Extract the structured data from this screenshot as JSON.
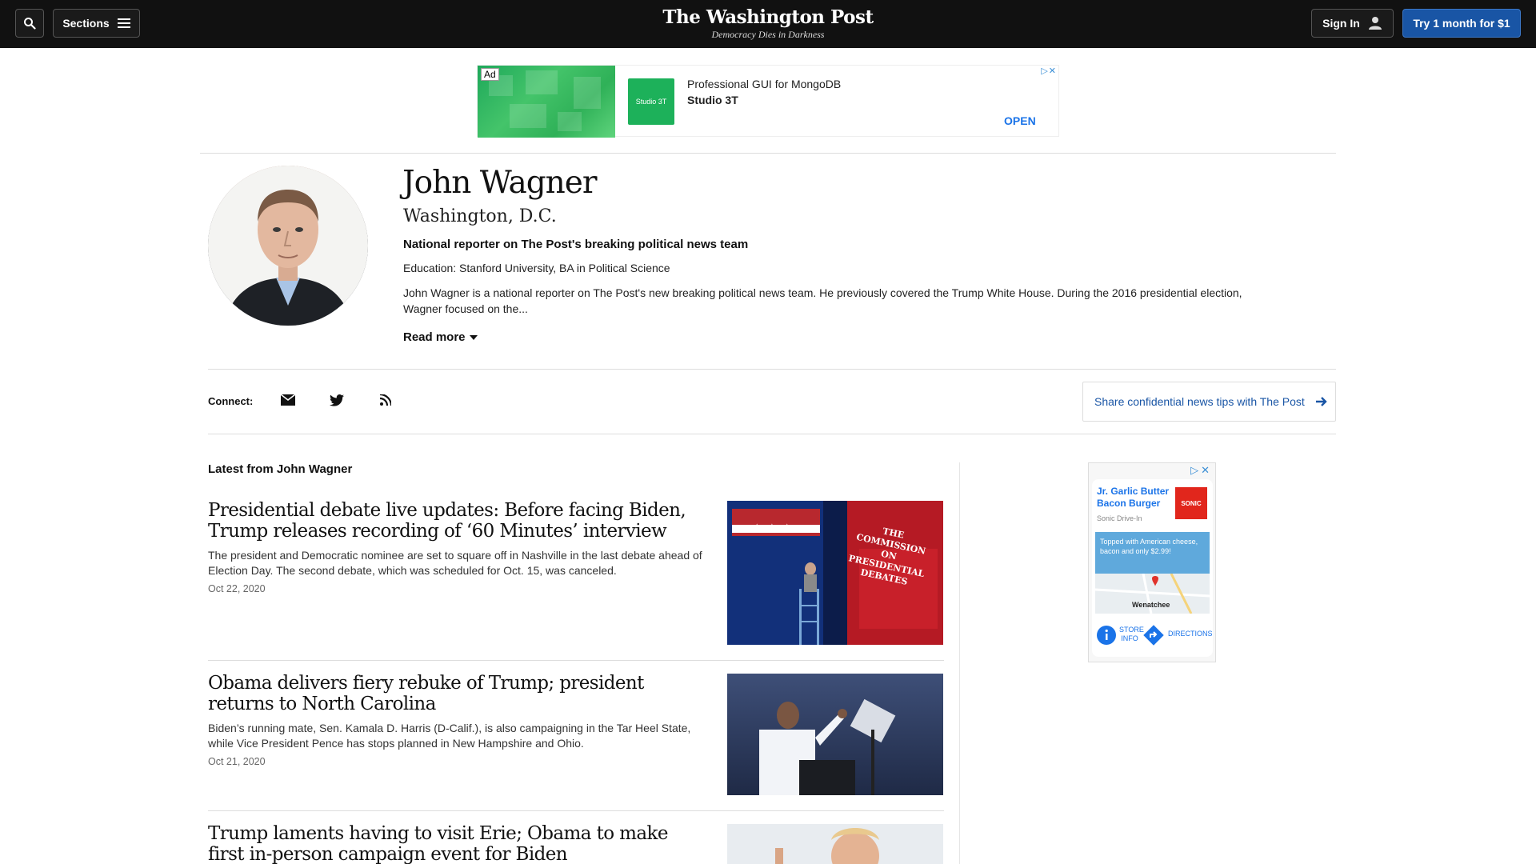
{
  "header": {
    "sections_label": "Sections",
    "logo_text": "The Washington Post",
    "tagline": "Democracy Dies in Darkness",
    "signin_label": "Sign In",
    "trial_label": "Try 1 month for $1"
  },
  "top_ad": {
    "badge": "Ad",
    "logo_text": "Studio 3T",
    "headline": "Professional GUI for MongoDB",
    "advertiser": "Studio 3T",
    "cta": "OPEN",
    "adchoices": "▷✕"
  },
  "profile": {
    "name": "John Wagner",
    "location": "Washington, D.C.",
    "role": "National reporter on The Post's breaking political news team",
    "education": "Education: Stanford University, BA in Political Science",
    "bio": "John Wagner is a national reporter on The Post's new breaking political news team. He previously covered the Trump White House. During the 2016 presidential election, Wagner focused on the...",
    "read_more": "Read more"
  },
  "connect": {
    "label": "Connect:",
    "icons": [
      "mail-icon",
      "twitter-icon",
      "rss-icon"
    ],
    "tips_label": "Share confidential news tips with The Post"
  },
  "latest": {
    "heading": "Latest from John Wagner",
    "stories": [
      {
        "title": "Presidential debate live updates: Before facing Biden, Trump releases recording of ‘60 Minutes’ interview",
        "blurb": "The president and Democratic nominee are set to square off in Nashville in the last debate ahead of Election Day. The second debate, which was scheduled for Oct. 15, was canceled.",
        "date": "Oct 22, 2020",
        "image_sign": "THE COMMISSION ON PRESIDENTIAL DEBATES"
      },
      {
        "title": "Obama delivers fiery rebuke of Trump; president returns to North Carolina",
        "blurb": "Biden’s running mate, Sen. Kamala D. Harris (D-Calif.), is also campaigning in the Tar Heel State, while Vice President Pence has stops planned in New Hampshire and Ohio.",
        "date": "Oct 21, 2020"
      },
      {
        "title": "Trump laments having to visit Erie; Obama to make first in-person campaign event for Biden"
      }
    ]
  },
  "side_ad": {
    "adchoices": "▷✕",
    "headline": "Jr. Garlic Butter Bacon Burger",
    "advertiser": "Sonic Drive-In",
    "logo_text": "SONIC",
    "promo": "Topped with American cheese, bacon and only $2.99!",
    "map_town": "Wenatchee",
    "store_info": "STORE INFO",
    "directions": "DIRECTIONS"
  },
  "colors": {
    "topbar": "#111111",
    "accent_blue": "#1955a5",
    "ad_green": "#1db15a",
    "sonic_red": "#e1261c"
  }
}
